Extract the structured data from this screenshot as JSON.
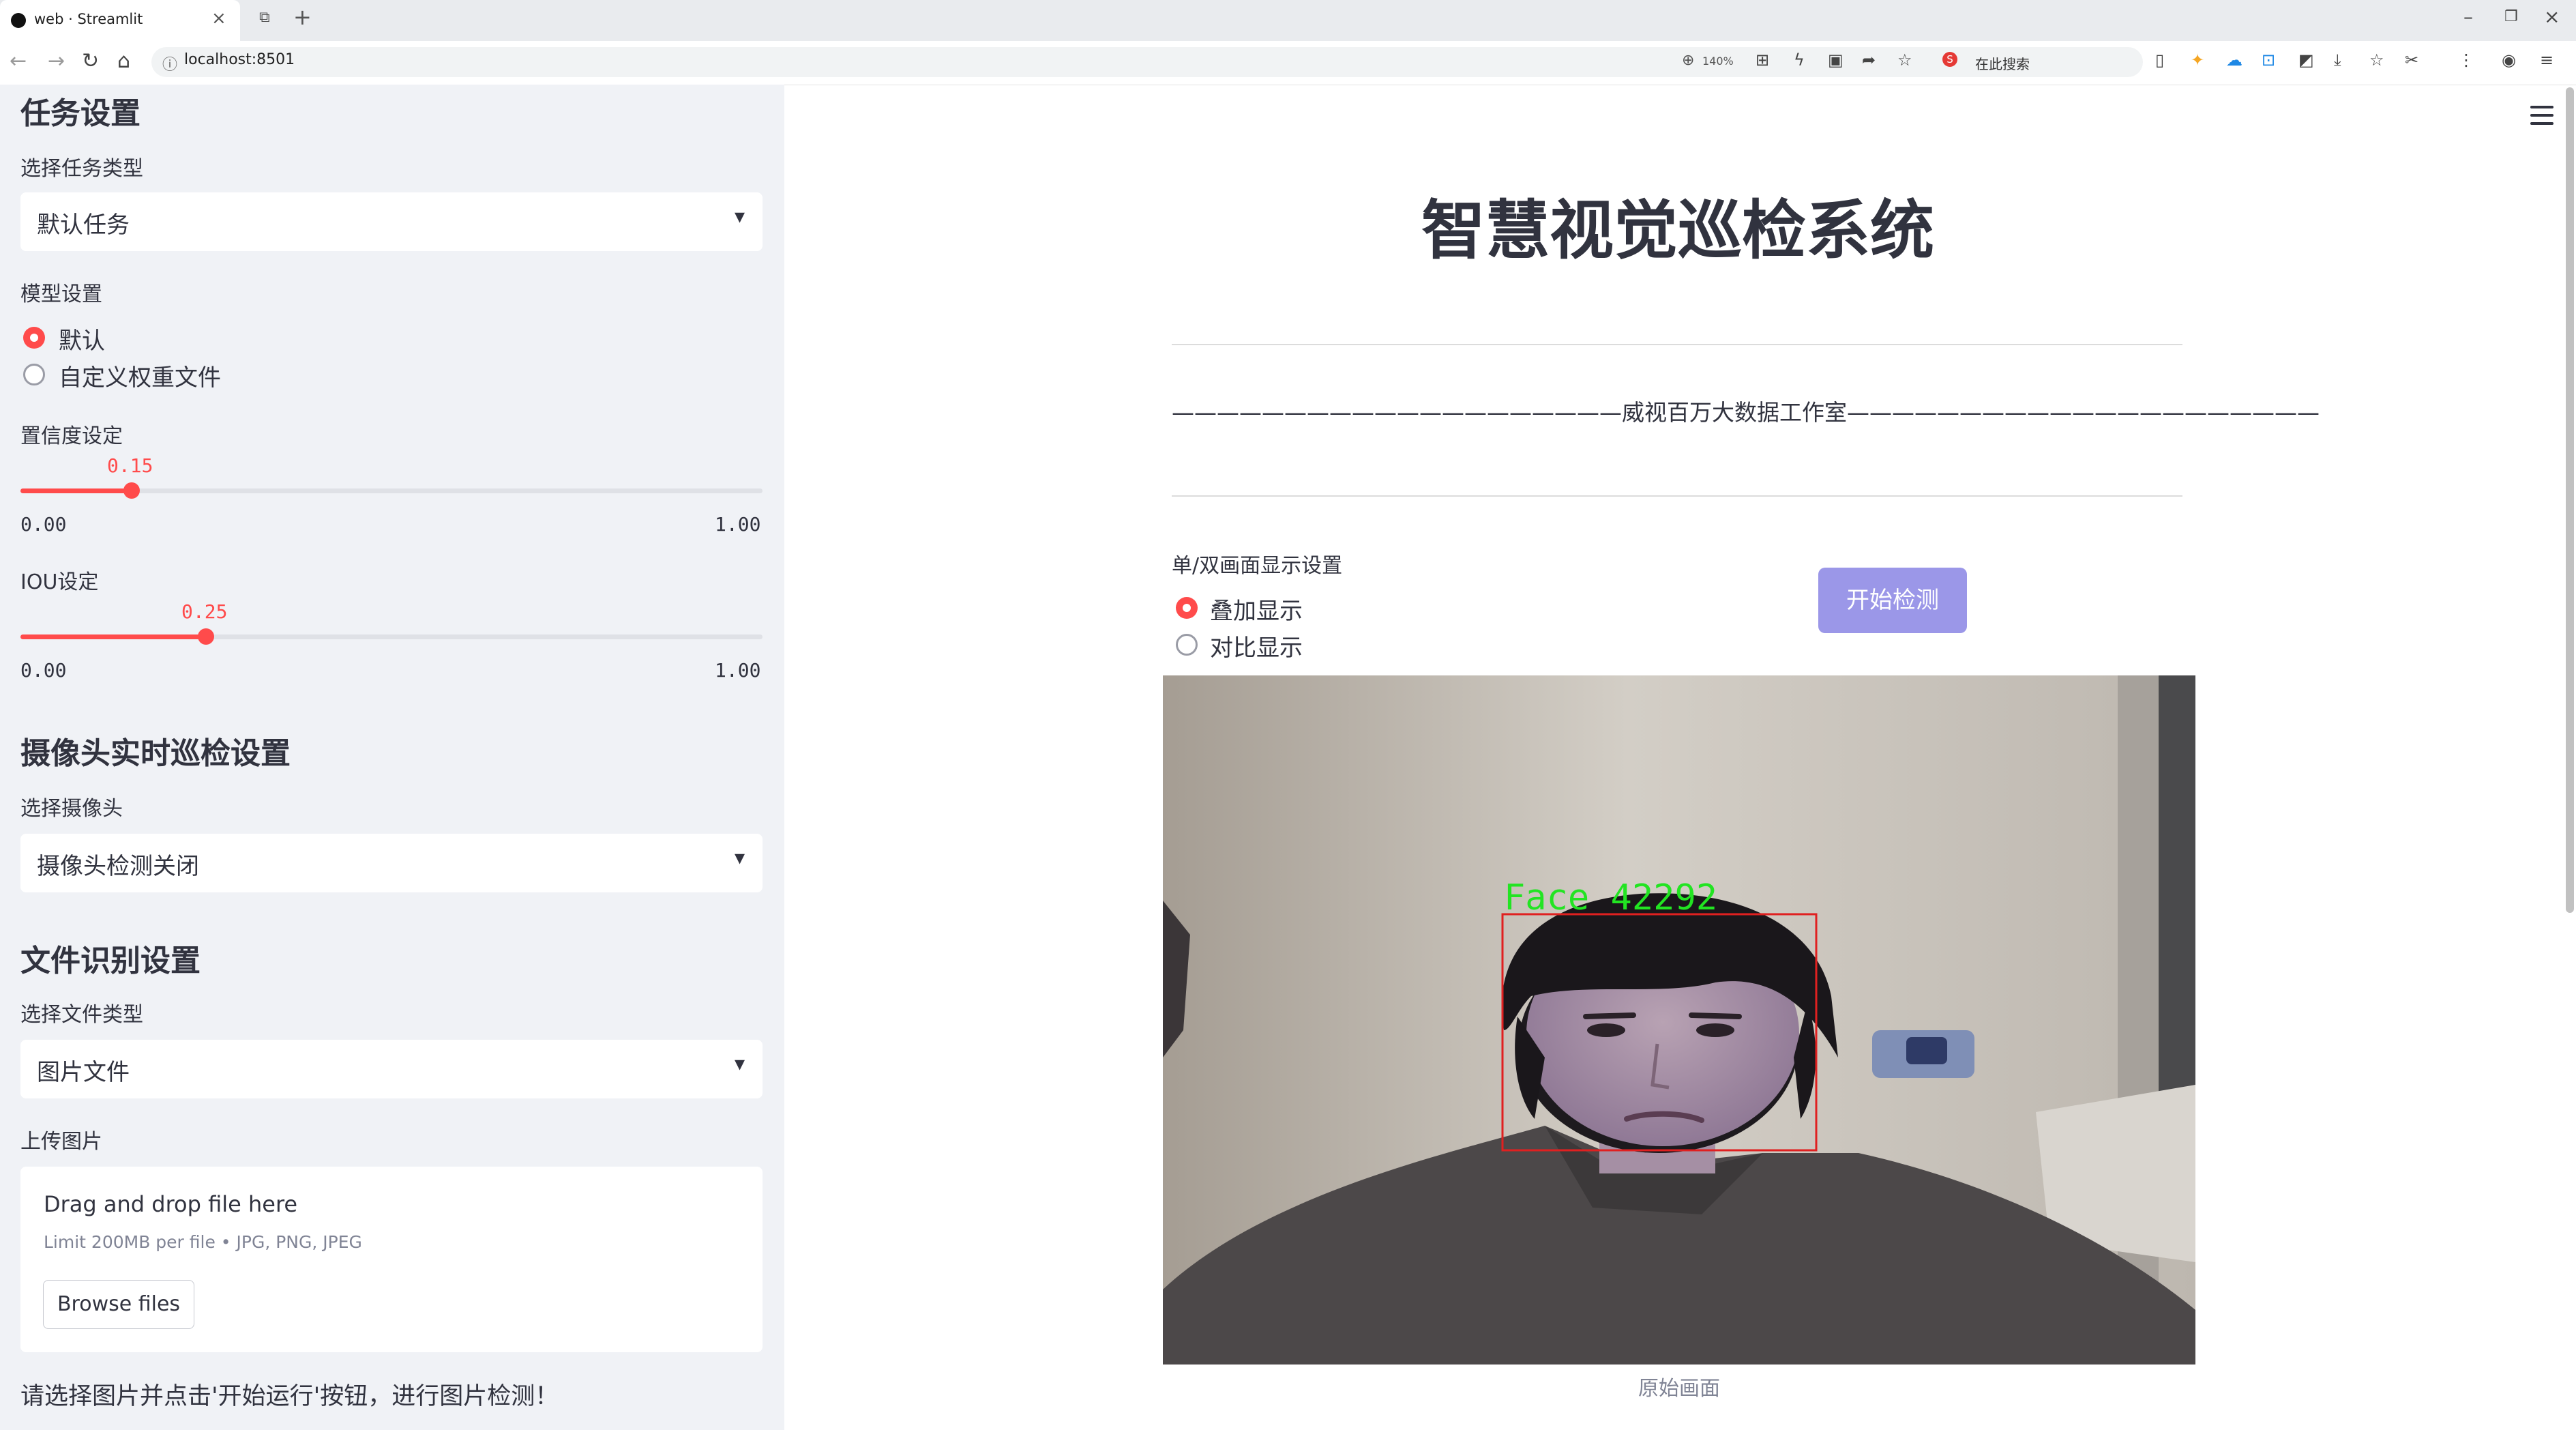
{
  "browser": {
    "tab_title": "web · Streamlit",
    "url": "localhost:8501",
    "zoom": "140%",
    "search_label": "在此搜索",
    "icons": [
      "back-icon",
      "forward-icon",
      "reload-icon",
      "home-icon",
      "zoom-icon",
      "translate-icon",
      "lightning-icon",
      "screenshot-icon",
      "share-icon",
      "star-icon",
      "bookmark-icon",
      "extension-icon",
      "download-icon",
      "scissors-icon",
      "menu-icon",
      "profile-icon"
    ]
  },
  "sidebar": {
    "task_header": "任务设置",
    "task_type_label": "选择任务类型",
    "task_type_value": "默认任务",
    "model_label": "模型设置",
    "model_options": [
      "默认",
      "自定义权重文件"
    ],
    "model_selected": 0,
    "confidence": {
      "label": "置信度设定",
      "value": "0.15",
      "min": "0.00",
      "max": "1.00",
      "fraction": 0.15
    },
    "iou": {
      "label": "IOU设定",
      "value": "0.25",
      "min": "0.00",
      "max": "1.00",
      "fraction": 0.25
    },
    "camera_header": "摄像头实时巡检设置",
    "camera_label": "选择摄像头",
    "camera_value": "摄像头检测关闭",
    "file_header": "文件识别设置",
    "file_type_label": "选择文件类型",
    "file_type_value": "图片文件",
    "upload_label": "上传图片",
    "upload_title": "Drag and drop file here",
    "upload_limit": "Limit 200MB per file • JPG, PNG, JPEG",
    "browse_button": "Browse files",
    "note": "请选择图片并点击'开始运行'按钮，进行图片检测！"
  },
  "main": {
    "title": "智慧视觉巡检系统",
    "studio_line": "————————————————————威视百万大数据工作室—————————————————————",
    "display_label": "单/双画面显示设置",
    "display_options": [
      "叠加显示",
      "对比显示"
    ],
    "display_selected": 0,
    "start_button": "开始检测",
    "detection_label": "Face  42292",
    "caption": "原始画面",
    "colors": {
      "accent": "#ff4b4b",
      "button": "#9b97e8",
      "detection_box": "#e02020",
      "detection_text": "#22e422"
    }
  }
}
